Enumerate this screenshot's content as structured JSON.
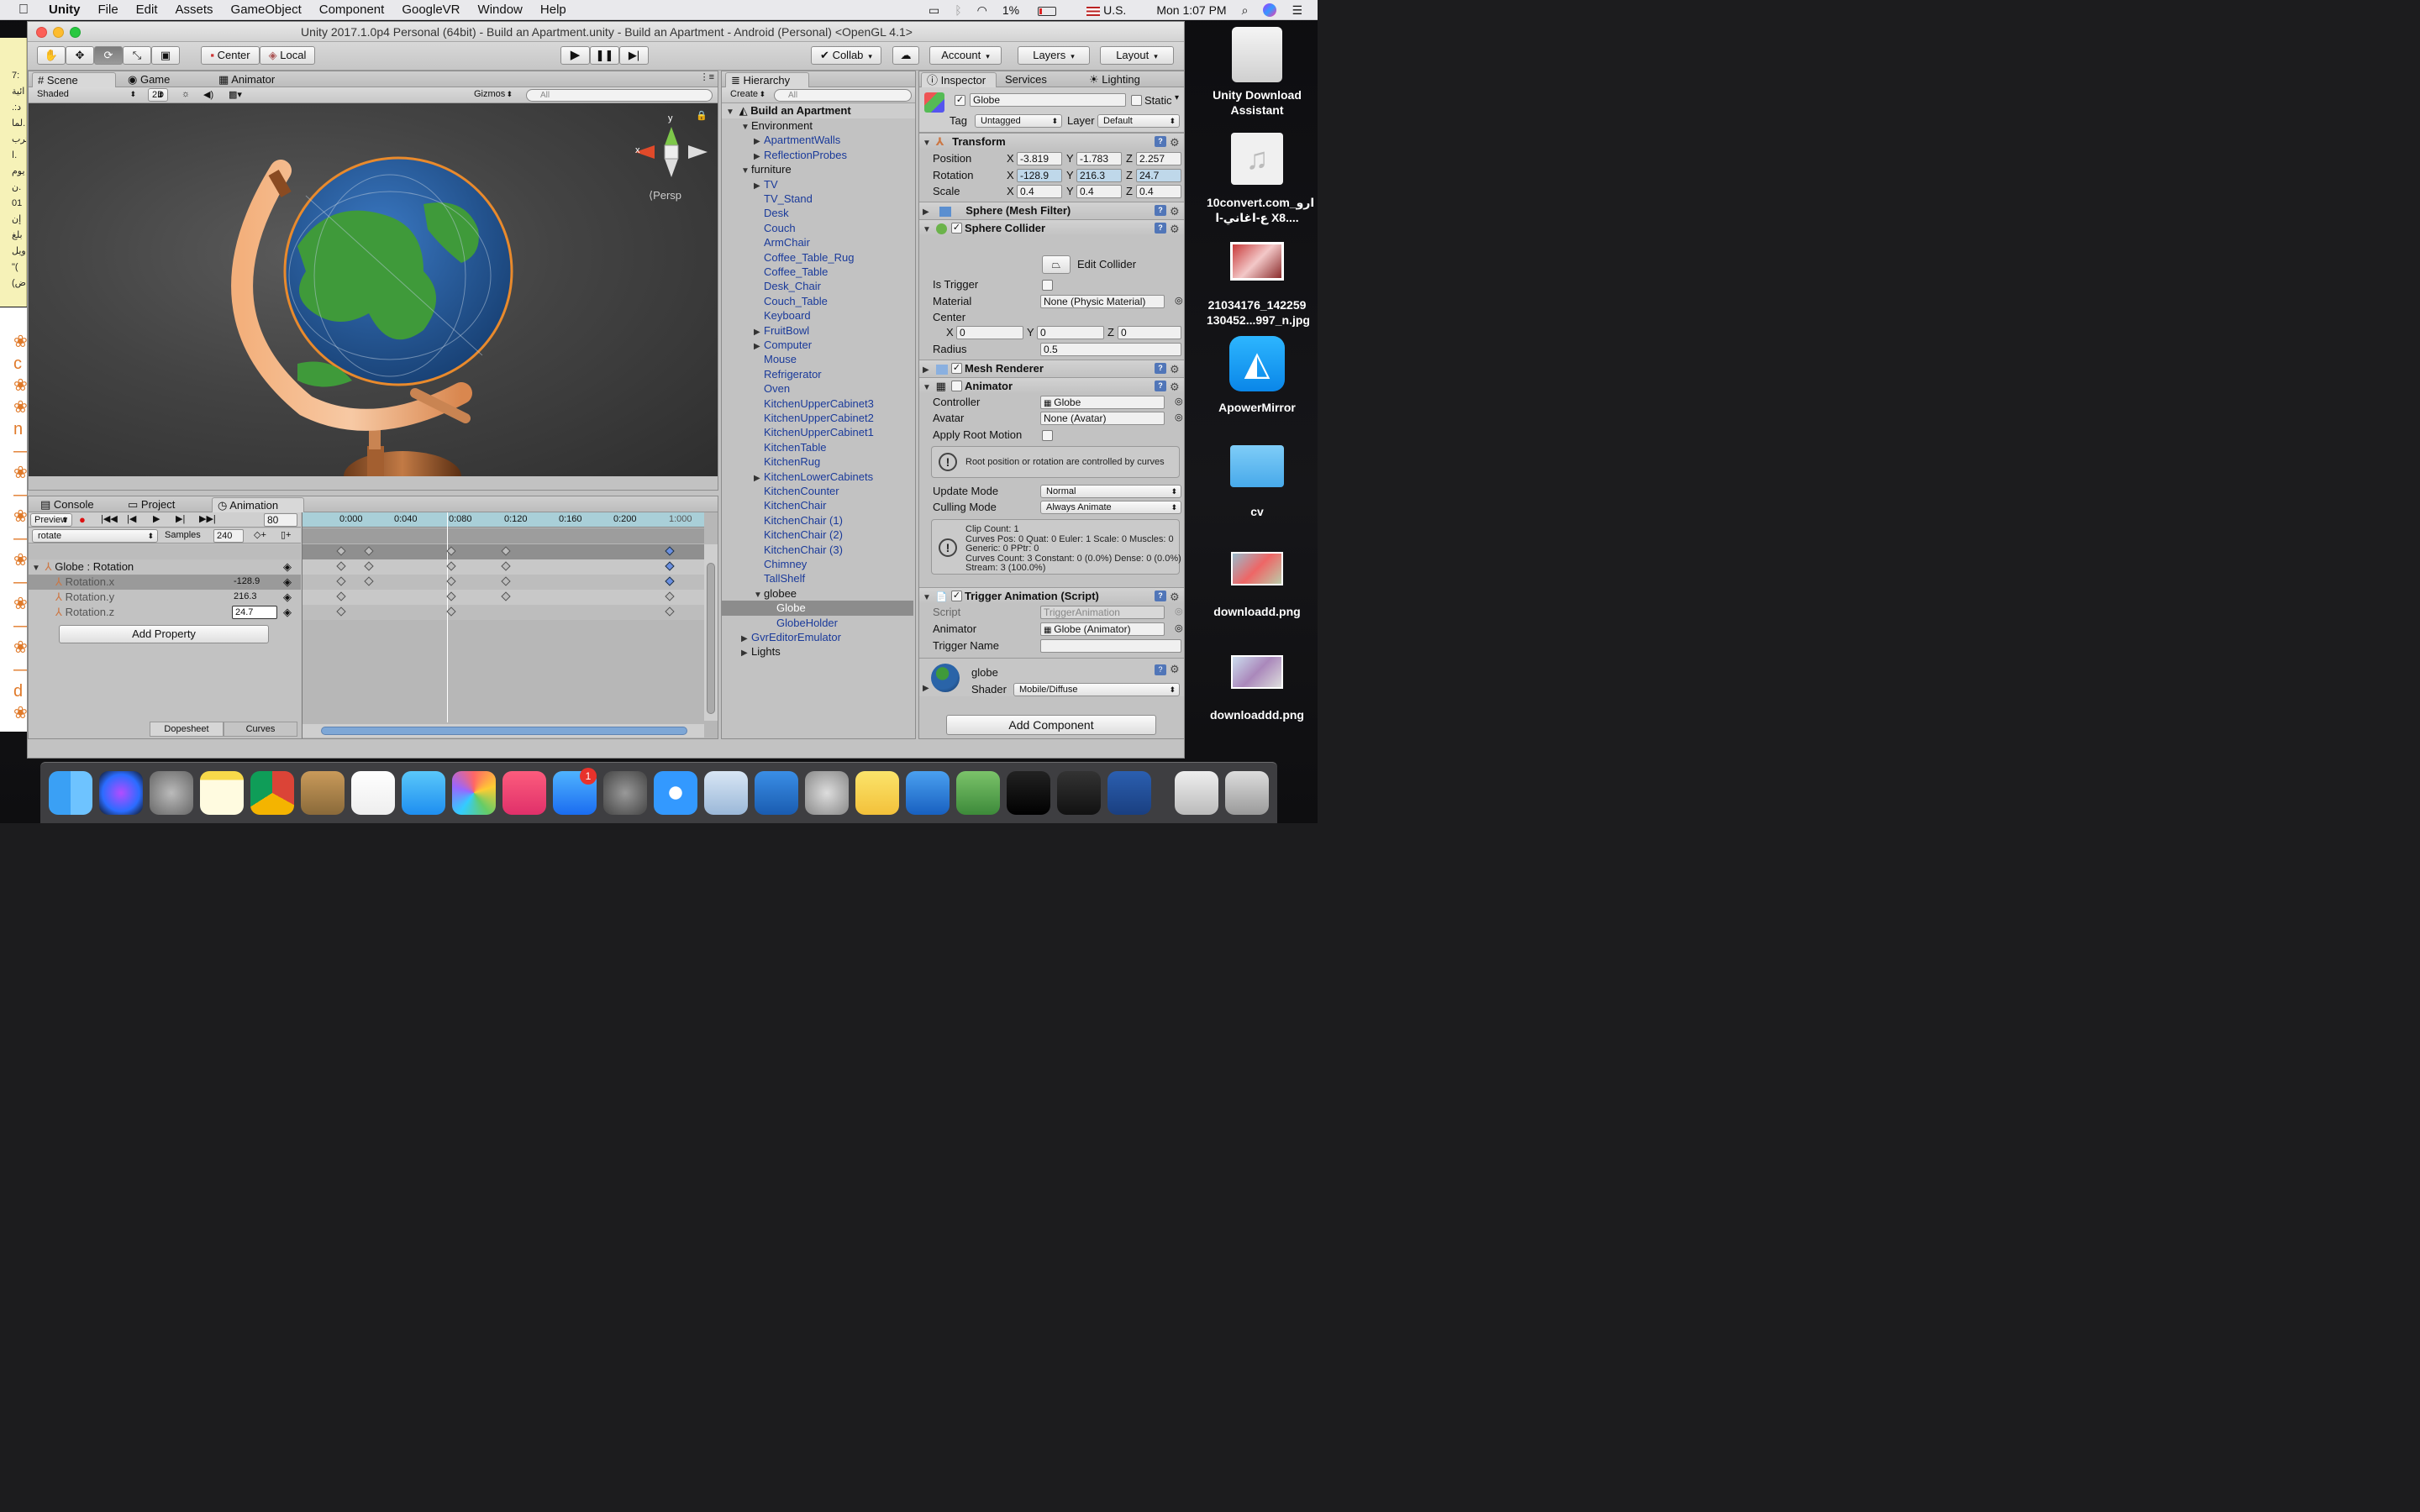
{
  "menubar": {
    "app": "Unity",
    "items": [
      "File",
      "Edit",
      "Assets",
      "GameObject",
      "Component",
      "GoogleVR",
      "Window",
      "Help"
    ],
    "battery": "1%",
    "input": "U.S.",
    "clock": "Mon 1:07 PM"
  },
  "window": {
    "title": "Unity 2017.1.0p4 Personal (64bit) - Build an Apartment.unity - Build an Apartment - Android (Personal) <OpenGL 4.1>"
  },
  "toolbar": {
    "pivot": "Center",
    "space": "Local",
    "collab": "Collab",
    "account": "Account",
    "layers": "Layers",
    "layout": "Layout"
  },
  "scene": {
    "tabs": [
      "Scene",
      "Game",
      "Animator"
    ],
    "shading": "Shaded",
    "mode2d": "2D",
    "gizmos": "Gizmos",
    "search_placeholder": "All",
    "persp": "Persp",
    "axis_x": "x",
    "axis_y": "y"
  },
  "hierarchy": {
    "tab": "Hierarchy",
    "create": "Create",
    "search_placeholder": "All",
    "scene_name": "Build an Apartment",
    "items": [
      {
        "label": "Environment",
        "indent": 1,
        "arrow": "open",
        "blue": false
      },
      {
        "label": "ApartmentWalls",
        "indent": 2,
        "arrow": "closed",
        "blue": true
      },
      {
        "label": "ReflectionProbes",
        "indent": 2,
        "arrow": "closed",
        "blue": true
      },
      {
        "label": "furniture",
        "indent": 1,
        "arrow": "open",
        "blue": false
      },
      {
        "label": "TV",
        "indent": 2,
        "arrow": "closed",
        "blue": true
      },
      {
        "label": "TV_Stand",
        "indent": 2,
        "arrow": "",
        "blue": true
      },
      {
        "label": "Desk",
        "indent": 2,
        "arrow": "",
        "blue": true
      },
      {
        "label": "Couch",
        "indent": 2,
        "arrow": "",
        "blue": true
      },
      {
        "label": "ArmChair",
        "indent": 2,
        "arrow": "",
        "blue": true
      },
      {
        "label": "Coffee_Table_Rug",
        "indent": 2,
        "arrow": "",
        "blue": true
      },
      {
        "label": "Coffee_Table",
        "indent": 2,
        "arrow": "",
        "blue": true
      },
      {
        "label": "Desk_Chair",
        "indent": 2,
        "arrow": "",
        "blue": true
      },
      {
        "label": "Couch_Table",
        "indent": 2,
        "arrow": "",
        "blue": true
      },
      {
        "label": "Keyboard",
        "indent": 2,
        "arrow": "",
        "blue": true
      },
      {
        "label": "FruitBowl",
        "indent": 2,
        "arrow": "closed",
        "blue": true
      },
      {
        "label": "Computer",
        "indent": 2,
        "arrow": "closed",
        "blue": true
      },
      {
        "label": "Mouse",
        "indent": 2,
        "arrow": "",
        "blue": true
      },
      {
        "label": "Refrigerator",
        "indent": 2,
        "arrow": "",
        "blue": true
      },
      {
        "label": "Oven",
        "indent": 2,
        "arrow": "",
        "blue": true
      },
      {
        "label": "KitchenUpperCabinet3",
        "indent": 2,
        "arrow": "",
        "blue": true
      },
      {
        "label": "KitchenUpperCabinet2",
        "indent": 2,
        "arrow": "",
        "blue": true
      },
      {
        "label": "KitchenUpperCabinet1",
        "indent": 2,
        "arrow": "",
        "blue": true
      },
      {
        "label": "KitchenTable",
        "indent": 2,
        "arrow": "",
        "blue": true
      },
      {
        "label": "KitchenRug",
        "indent": 2,
        "arrow": "",
        "blue": true
      },
      {
        "label": "KitchenLowerCabinets",
        "indent": 2,
        "arrow": "closed",
        "blue": true
      },
      {
        "label": "KitchenCounter",
        "indent": 2,
        "arrow": "",
        "blue": true
      },
      {
        "label": "KitchenChair",
        "indent": 2,
        "arrow": "",
        "blue": true
      },
      {
        "label": "KitchenChair (1)",
        "indent": 2,
        "arrow": "",
        "blue": true
      },
      {
        "label": "KitchenChair (2)",
        "indent": 2,
        "arrow": "",
        "blue": true
      },
      {
        "label": "KitchenChair (3)",
        "indent": 2,
        "arrow": "",
        "blue": true
      },
      {
        "label": "Chimney",
        "indent": 2,
        "arrow": "",
        "blue": true
      },
      {
        "label": "TallShelf",
        "indent": 2,
        "arrow": "",
        "blue": true
      },
      {
        "label": "globee",
        "indent": 2,
        "arrow": "open",
        "blue": false
      },
      {
        "label": "Globe",
        "indent": 3,
        "arrow": "",
        "blue": true,
        "selected": true
      },
      {
        "label": "GlobeHolder",
        "indent": 3,
        "arrow": "",
        "blue": true
      },
      {
        "label": "GvrEditorEmulator",
        "indent": 1,
        "arrow": "closed",
        "blue": true
      },
      {
        "label": "Lights",
        "indent": 1,
        "arrow": "closed",
        "blue": false
      }
    ]
  },
  "inspector": {
    "tabs": [
      "Inspector",
      "Services",
      "Lighting"
    ],
    "object_name": "Globe",
    "static": "Static",
    "tag_label": "Tag",
    "tag": "Untagged",
    "layer_label": "Layer",
    "layer": "Default",
    "transform": {
      "title": "Transform",
      "position_label": "Position",
      "pos": [
        "-3.819",
        "-1.783",
        "2.257"
      ],
      "rotation_label": "Rotation",
      "rot": [
        "-128.9",
        "216.3",
        "24.7"
      ],
      "scale_label": "Scale",
      "scale": [
        "0.4",
        "0.4",
        "0.4"
      ],
      "x": "X",
      "y": "Y",
      "z": "Z"
    },
    "mesh_filter": "Sphere (Mesh Filter)",
    "collider": {
      "title": "Sphere Collider",
      "edit": "Edit Collider",
      "is_trigger": "Is Trigger",
      "material_label": "Material",
      "material": "None (Physic Material)",
      "center_label": "Center",
      "center": [
        "0",
        "0",
        "0"
      ],
      "radius_label": "Radius",
      "radius": "0.5"
    },
    "mesh_renderer": "Mesh Renderer",
    "animator": {
      "title": "Animator",
      "controller_label": "Controller",
      "controller": "Globe",
      "avatar_label": "Avatar",
      "avatar": "None (Avatar)",
      "root_motion": "Apply Root Motion",
      "root_note": "Root position or rotation are controlled by curves",
      "update_label": "Update Mode",
      "update": "Normal",
      "culling_label": "Culling Mode",
      "culling": "Always Animate",
      "stats": [
        "Clip Count: 1",
        "Curves Pos: 0 Quat: 0 Euler: 1 Scale: 0 Muscles: 0",
        "Generic: 0 PPtr: 0",
        "Curves Count: 3 Constant: 0 (0.0%) Dense: 0 (0.0%)",
        "Stream: 3 (100.0%)"
      ]
    },
    "trigger": {
      "title": "Trigger Animation (Script)",
      "script_label": "Script",
      "script": "TriggerAnimation",
      "animator_label": "Animator",
      "animator": "Globe (Animator)",
      "name_label": "Trigger Name"
    },
    "material": {
      "name": "globe",
      "shader_label": "Shader",
      "shader": "Mobile/Diffuse"
    },
    "add_component": "Add Component"
  },
  "animation": {
    "tabs": [
      "Console",
      "Project",
      "Animation"
    ],
    "preview": "Preview",
    "frame": "80",
    "clip": "rotate",
    "samples_label": "Samples",
    "samples": "240",
    "ticks": [
      "0:000",
      "0:040",
      "0:080",
      "0:120",
      "0:160",
      "0:200",
      "1:000"
    ],
    "group": "Globe : Rotation",
    "properties": [
      {
        "name": "Rotation.x",
        "value": "-128.9"
      },
      {
        "name": "Rotation.y",
        "value": "216.3"
      },
      {
        "name": "Rotation.z",
        "value": "24.7"
      }
    ],
    "add_property": "Add Property",
    "dopesheet": "Dopesheet",
    "curves": "Curves"
  },
  "desktop": {
    "icons": [
      {
        "label": "Unity Download Assistant"
      },
      {
        "label": "10convert.com_ارو ع-اغاني-ا X8...."
      },
      {
        "label": "21034176_142259 130452...997_n.jpg"
      },
      {
        "label": "ApowerMirror"
      },
      {
        "label": "cv"
      },
      {
        "label": "downloadd.png"
      },
      {
        "label": "downloaddd.png"
      }
    ]
  },
  "dock": {
    "badge": "1"
  }
}
